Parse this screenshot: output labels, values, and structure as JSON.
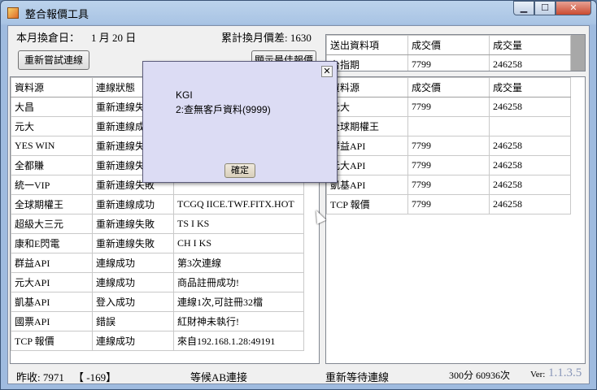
{
  "window": {
    "title": "整合報價工具",
    "min_icon": "minimize-icon",
    "max_icon": "maximize-icon",
    "close_icon": "close-icon"
  },
  "header": {
    "date_label": "本月換倉日：",
    "date_value": "1 月 20 日",
    "spread_text": "累計換月價差: 1630",
    "retry_button": "重新嘗試連線",
    "best_quote_button": "顯示最佳報價"
  },
  "left_grid": {
    "columns": [
      "資料源",
      "連線狀態",
      ""
    ],
    "rows": [
      [
        "大昌",
        "重新連線失敗",
        ""
      ],
      [
        "元大",
        "重新連線成功",
        ""
      ],
      [
        "YES WIN",
        "重新連線失敗",
        ""
      ],
      [
        "全都賺",
        "重新連線失敗",
        ""
      ],
      [
        "統一VIP",
        "重新連線失敗",
        ""
      ],
      [
        "全球期權王",
        "重新連線成功",
        "TCGQ IICE.TWF.FITX.HOT"
      ],
      [
        "超級大三元",
        "重新連線失敗",
        "TS I KS"
      ],
      [
        "康和E閃電",
        "重新連線失敗",
        "CH I KS"
      ],
      [
        "群益API",
        "連線成功",
        "第3次連線"
      ],
      [
        "元大API",
        "連線成功",
        "商品註冊成功!"
      ],
      [
        "凱基API",
        "登入成功",
        "連線1次,可註冊32檔"
      ],
      [
        "國票API",
        "錯誤",
        "紅財神未執行!"
      ],
      [
        "TCP 報價",
        "連線成功",
        "來自192.168.1.28:49191"
      ]
    ]
  },
  "send_grid": {
    "columns": [
      "送出資料項",
      "成交價",
      "成交量"
    ],
    "rows": [
      [
        "台指期",
        "7799",
        "246258"
      ]
    ]
  },
  "right_grid": {
    "columns": [
      "資料源",
      "成交價",
      "成交量"
    ],
    "rows": [
      [
        "元大",
        "7799",
        "246258"
      ],
      [
        "全球期權王",
        "",
        ""
      ],
      [
        "群益API",
        "7799",
        "246258"
      ],
      [
        "元大API",
        "7799",
        "246258"
      ],
      [
        "凱基API",
        "7799",
        "246258"
      ],
      [
        "TCP 報價",
        "7799",
        "246258"
      ]
    ]
  },
  "dialog": {
    "title": "KGI",
    "message": "2:查無客戶資料(9999)",
    "ok_button": "確定",
    "close_icon": "close-icon"
  },
  "status": {
    "yesterday_close": "昨收: 7971",
    "change": "【 -169】",
    "ab_status": "等候AB連接",
    "reconnect_status": "重新等待連線",
    "time_counter": "300分 60936次",
    "version_label": "Ver:",
    "version_value": "1.1.3.5"
  }
}
